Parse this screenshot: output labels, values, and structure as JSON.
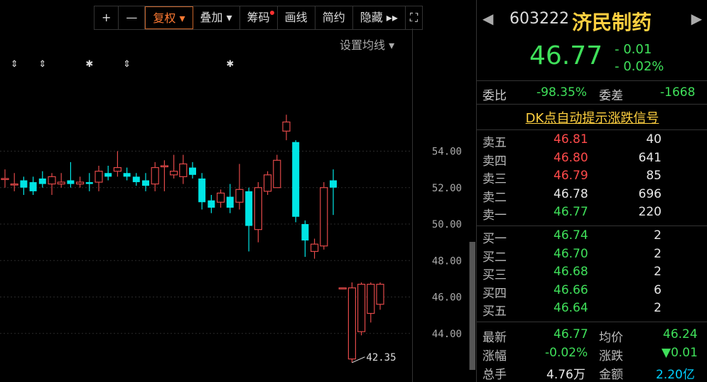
{
  "toolbar": {
    "buttons": [
      "+",
      "—",
      "复权 ▾",
      "叠加 ▾",
      "筹码",
      "画线",
      "简约",
      "隐藏 ▸▸",
      "⛶"
    ]
  },
  "ma_setting_label": "设置均线 ▾",
  "colors": {
    "up": "#e04848",
    "down": "#00e5e5",
    "green": "#3fe05a",
    "red": "#ff4a4a"
  },
  "chart_data": {
    "type": "candlestick",
    "y_ticks": [
      "54.00",
      "52.00",
      "50.00",
      "48.00",
      "46.00",
      "44.00"
    ],
    "ylim": [
      42.0,
      58.0
    ],
    "last_label": "42.35",
    "candles": [
      {
        "o": 52.5,
        "c": 52.5,
        "h": 53.0,
        "l": 52.0
      },
      {
        "o": 52.2,
        "c": 52.2,
        "h": 52.8,
        "l": 51.8
      },
      {
        "o": 52.4,
        "c": 52.0,
        "h": 52.6,
        "l": 51.6
      },
      {
        "o": 52.3,
        "c": 51.8,
        "h": 52.6,
        "l": 51.6
      },
      {
        "o": 52.5,
        "c": 52.2,
        "h": 52.9,
        "l": 52.0
      },
      {
        "o": 52.2,
        "c": 52.6,
        "h": 52.8,
        "l": 51.6
      },
      {
        "o": 52.2,
        "c": 52.3,
        "h": 52.8,
        "l": 52.0
      },
      {
        "o": 52.4,
        "c": 52.2,
        "h": 53.4,
        "l": 52.0
      },
      {
        "o": 52.2,
        "c": 52.3,
        "h": 52.6,
        "l": 52.0
      },
      {
        "o": 52.3,
        "c": 52.2,
        "h": 52.8,
        "l": 51.8
      },
      {
        "o": 52.3,
        "c": 52.9,
        "h": 53.2,
        "l": 51.8
      },
      {
        "o": 52.8,
        "c": 52.6,
        "h": 53.2,
        "l": 52.4
      },
      {
        "o": 52.9,
        "c": 53.1,
        "h": 54.0,
        "l": 52.6
      },
      {
        "o": 52.8,
        "c": 52.6,
        "h": 53.1,
        "l": 52.4
      },
      {
        "o": 52.6,
        "c": 52.3,
        "h": 52.8,
        "l": 52.1
      },
      {
        "o": 52.4,
        "c": 52.1,
        "h": 52.8,
        "l": 51.8
      },
      {
        "o": 52.2,
        "c": 53.1,
        "h": 53.4,
        "l": 51.8
      },
      {
        "o": 53.2,
        "c": 53.2,
        "h": 53.5,
        "l": 51.8
      },
      {
        "o": 52.7,
        "c": 52.9,
        "h": 53.8,
        "l": 52.5
      },
      {
        "o": 52.6,
        "c": 53.3,
        "h": 53.8,
        "l": 52.2
      },
      {
        "o": 53.1,
        "c": 52.7,
        "h": 53.4,
        "l": 52.5
      },
      {
        "o": 52.5,
        "c": 51.2,
        "h": 52.8,
        "l": 50.8
      },
      {
        "o": 51.3,
        "c": 50.9,
        "h": 51.6,
        "l": 50.6
      },
      {
        "o": 51.2,
        "c": 51.7,
        "h": 51.9,
        "l": 50.9
      },
      {
        "o": 51.5,
        "c": 50.9,
        "h": 52.2,
        "l": 50.6
      },
      {
        "o": 51.2,
        "c": 51.9,
        "h": 53.3,
        "l": 50.8
      },
      {
        "o": 51.8,
        "c": 49.9,
        "h": 52.0,
        "l": 48.5
      },
      {
        "o": 49.7,
        "c": 52.0,
        "h": 52.3,
        "l": 49.0
      },
      {
        "o": 51.8,
        "c": 52.7,
        "h": 52.9,
        "l": 51.6
      },
      {
        "o": 52.0,
        "c": 53.5,
        "h": 53.8,
        "l": 52.0
      },
      {
        "o": 55.1,
        "c": 55.6,
        "h": 56.0,
        "l": 54.6
      },
      {
        "o": 54.5,
        "c": 50.4,
        "h": 54.6,
        "l": 50.1
      },
      {
        "o": 50.0,
        "c": 49.1,
        "h": 50.2,
        "l": 48.2
      },
      {
        "o": 48.5,
        "c": 48.9,
        "h": 49.2,
        "l": 48.1
      },
      {
        "o": 48.8,
        "c": 52.0,
        "h": 52.3,
        "l": 48.6
      },
      {
        "o": 52.4,
        "c": 52.0,
        "h": 53.0,
        "l": 50.5
      },
      {
        "o": 46.5,
        "c": 46.5,
        "h": 46.5,
        "l": 46.5
      },
      {
        "o": 42.6,
        "c": 46.5,
        "h": 46.8,
        "l": 42.4
      },
      {
        "o": 44.1,
        "c": 46.7,
        "h": 46.8,
        "l": 43.9
      },
      {
        "o": 45.1,
        "c": 46.7,
        "h": 46.8,
        "l": 44.6
      },
      {
        "o": 45.6,
        "c": 46.7,
        "h": 46.8,
        "l": 45.3
      }
    ],
    "markers": [
      {
        "index": 1,
        "symbol": "⇕"
      },
      {
        "index": 4,
        "symbol": "⇕"
      },
      {
        "index": 9,
        "symbol": "✱"
      },
      {
        "index": 13,
        "symbol": "⇕"
      },
      {
        "index": 24,
        "symbol": "✱"
      }
    ]
  },
  "quote": {
    "code": "603222",
    "name": "济民制药",
    "price": "46.77",
    "change": "- 0.01",
    "change_pct": "- 0.02%",
    "weibi_label": "委比",
    "weibi_value": "-98.35%",
    "weicha_label": "委差",
    "weicha_value": "-1668",
    "signal_text": "DK点自动提示涨跌信号",
    "sells": [
      {
        "label": "卖五",
        "price": "46.81",
        "vol": "40",
        "color": "#ff4a4a"
      },
      {
        "label": "卖四",
        "price": "46.80",
        "vol": "641",
        "color": "#ff4a4a"
      },
      {
        "label": "卖三",
        "price": "46.79",
        "vol": "85",
        "color": "#ff4a4a"
      },
      {
        "label": "卖二",
        "price": "46.78",
        "vol": "696",
        "color": "#e8e8e8"
      },
      {
        "label": "卖一",
        "price": "46.77",
        "vol": "220",
        "color": "#3fe05a"
      }
    ],
    "buys": [
      {
        "label": "买一",
        "price": "46.74",
        "vol": "2",
        "color": "#3fe05a"
      },
      {
        "label": "买二",
        "price": "46.70",
        "vol": "2",
        "color": "#3fe05a"
      },
      {
        "label": "买三",
        "price": "46.68",
        "vol": "2",
        "color": "#3fe05a"
      },
      {
        "label": "买四",
        "price": "46.66",
        "vol": "6",
        "color": "#3fe05a"
      },
      {
        "label": "买五",
        "price": "46.64",
        "vol": "2",
        "color": "#3fe05a"
      }
    ],
    "stats": {
      "latest_label": "最新",
      "latest": "46.77",
      "avg_label": "均价",
      "avg": "46.24",
      "pct_label": "涨幅",
      "pct": "-0.02%",
      "change_label": "涨跌",
      "change": "▼0.01",
      "vol_label": "总手",
      "vol": "4.76万",
      "amount_label": "金额",
      "amount": "2.20亿"
    }
  }
}
